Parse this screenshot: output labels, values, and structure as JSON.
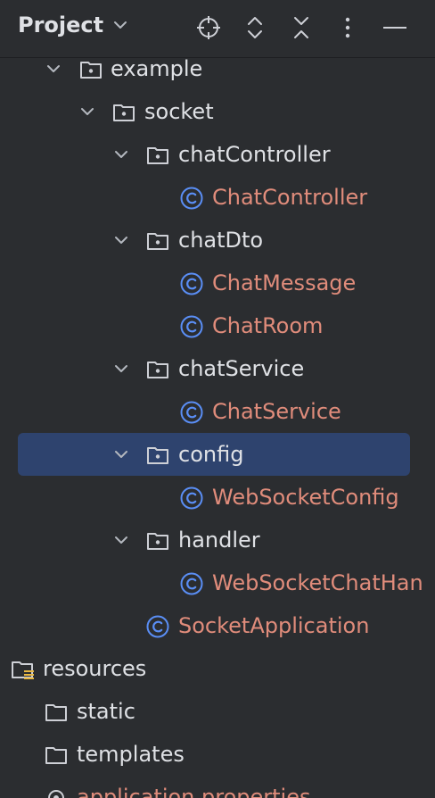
{
  "header": {
    "title": "Project",
    "icons": [
      "chevron-down-icon",
      "locate-icon",
      "expand-all-icon",
      "collapse-all-icon",
      "more-options-icon",
      "minimize-icon"
    ]
  },
  "colors": {
    "background": "#2b2d30",
    "selection": "#2e436e",
    "class_text": "#e08c7b",
    "class_icon": "#5a8ef5",
    "folder_text": "#dfe1e5"
  },
  "tree": {
    "items": [
      {
        "label": "example",
        "type": "package",
        "expanded": true
      },
      {
        "label": "socket",
        "type": "package",
        "expanded": true
      },
      {
        "label": "chatController",
        "type": "package",
        "expanded": true
      },
      {
        "label": "ChatController",
        "type": "class"
      },
      {
        "label": "chatDto",
        "type": "package",
        "expanded": true
      },
      {
        "label": "ChatMessage",
        "type": "class"
      },
      {
        "label": "ChatRoom",
        "type": "class"
      },
      {
        "label": "chatService",
        "type": "package",
        "expanded": true
      },
      {
        "label": "ChatService",
        "type": "class"
      },
      {
        "label": "config",
        "type": "package",
        "expanded": true,
        "selected": true
      },
      {
        "label": "WebSocketConfig",
        "type": "class"
      },
      {
        "label": "handler",
        "type": "package",
        "expanded": true
      },
      {
        "label": "WebSocketChatHan",
        "type": "class"
      },
      {
        "label": "SocketApplication",
        "type": "class"
      },
      {
        "label": "resources",
        "type": "resources-folder"
      },
      {
        "label": "static",
        "type": "folder"
      },
      {
        "label": "templates",
        "type": "folder"
      },
      {
        "label": "application.properties",
        "type": "properties-file"
      }
    ]
  }
}
